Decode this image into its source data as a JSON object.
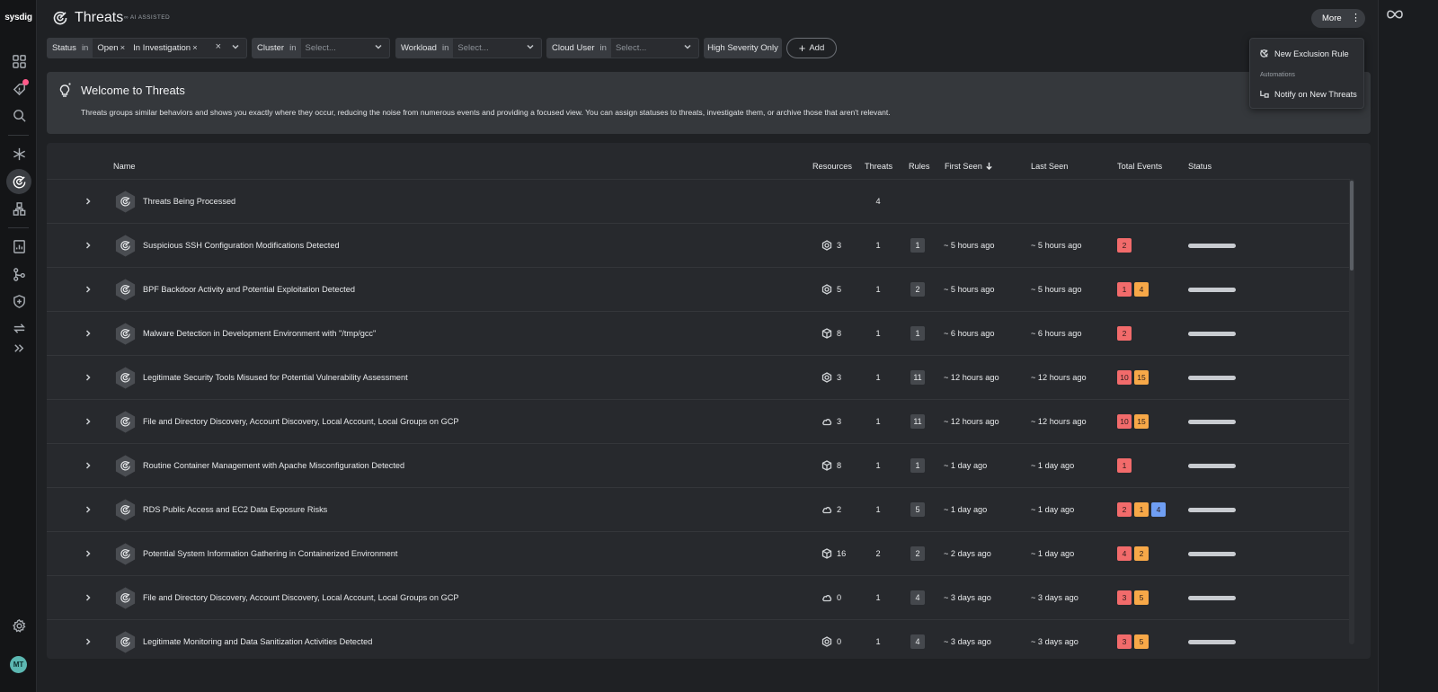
{
  "nav": {
    "logo": "sysdig",
    "avatar_initials": "MT"
  },
  "header": {
    "title": "Threats",
    "ai_badge": "AI ASSISTED",
    "more_label": "More"
  },
  "filters": {
    "status": {
      "name": "Status",
      "op": "in",
      "chips": [
        "Open",
        "In Investigation"
      ]
    },
    "cluster": {
      "name": "Cluster",
      "op": "in",
      "placeholder": "Select..."
    },
    "workload": {
      "name": "Workload",
      "op": "in",
      "placeholder": "Select..."
    },
    "cloud_user": {
      "name": "Cloud User",
      "op": "in",
      "placeholder": "Select..."
    },
    "high_severity_label": "High Severity Only",
    "add_label": "Add"
  },
  "menu": {
    "new_exclusion_rule": "New Exclusion Rule",
    "section": "Automations",
    "notify_new_threats": "Notify on New Threats"
  },
  "welcome": {
    "title": "Welcome to Threats",
    "text": "Threats groups similar behaviors and shows you exactly where they occur, reducing the noise from numerous events and providing a focused view. You can assign statuses to threats, investigate them, or archive those that aren't relevant."
  },
  "table": {
    "columns": {
      "name": "Name",
      "resources": "Resources",
      "threats": "Threats",
      "rules": "Rules",
      "first_seen": "First Seen",
      "last_seen": "Last Seen",
      "total_events": "Total Events",
      "status": "Status"
    },
    "rows": [
      {
        "name": "Threats Being Processed",
        "resource_icon": "",
        "resources": "",
        "threats": "4",
        "rules": "",
        "first_seen": "",
        "last_seen": "",
        "events": [],
        "status": false
      },
      {
        "name": "Suspicious SSH Configuration Modifications Detected",
        "resource_icon": "host-icon",
        "resources": "3",
        "threats": "1",
        "rules": "1",
        "first_seen": "~ 5 hours ago",
        "last_seen": "~ 5 hours ago",
        "events": [
          {
            "v": "2",
            "sev": "high"
          }
        ],
        "status": true
      },
      {
        "name": "BPF Backdoor Activity and Potential Exploitation Detected",
        "resource_icon": "host-icon",
        "resources": "5",
        "threats": "1",
        "rules": "2",
        "first_seen": "~ 5 hours ago",
        "last_seen": "~ 5 hours ago",
        "events": [
          {
            "v": "1",
            "sev": "high"
          },
          {
            "v": "4",
            "sev": "med"
          }
        ],
        "status": true
      },
      {
        "name": "Malware Detection in Development Environment with \"/tmp/gcc\"",
        "resource_icon": "container-icon",
        "resources": "8",
        "threats": "1",
        "rules": "1",
        "first_seen": "~ 6 hours ago",
        "last_seen": "~ 6 hours ago",
        "events": [
          {
            "v": "2",
            "sev": "high"
          }
        ],
        "status": true
      },
      {
        "name": "Legitimate Security Tools Misused for Potential Vulnerability Assessment",
        "resource_icon": "host-icon",
        "resources": "3",
        "threats": "1",
        "rules": "11",
        "first_seen": "~ 12 hours ago",
        "last_seen": "~ 12 hours ago",
        "events": [
          {
            "v": "10",
            "sev": "high"
          },
          {
            "v": "15",
            "sev": "med"
          }
        ],
        "status": true
      },
      {
        "name": "File and Directory Discovery, Account Discovery, Local Account, Local Groups on GCP",
        "resource_icon": "cloud-icon",
        "resources": "3",
        "threats": "1",
        "rules": "11",
        "first_seen": "~ 12 hours ago",
        "last_seen": "~ 12 hours ago",
        "events": [
          {
            "v": "10",
            "sev": "high"
          },
          {
            "v": "15",
            "sev": "med"
          }
        ],
        "status": true
      },
      {
        "name": "Routine Container Management with Apache Misconfiguration Detected",
        "resource_icon": "container-icon",
        "resources": "8",
        "threats": "1",
        "rules": "1",
        "first_seen": "~ 1 day ago",
        "last_seen": "~ 1 day ago",
        "events": [
          {
            "v": "1",
            "sev": "high"
          }
        ],
        "status": true
      },
      {
        "name": "RDS Public Access and EC2 Data Exposure Risks",
        "resource_icon": "cloud-icon",
        "resources": "2",
        "threats": "1",
        "rules": "5",
        "first_seen": "~ 1 day ago",
        "last_seen": "~ 1 day ago",
        "events": [
          {
            "v": "2",
            "sev": "high"
          },
          {
            "v": "1",
            "sev": "med"
          },
          {
            "v": "4",
            "sev": "low"
          }
        ],
        "status": true
      },
      {
        "name": "Potential System Information Gathering in Containerized Environment",
        "resource_icon": "container-icon",
        "resources": "16",
        "threats": "2",
        "rules": "2",
        "first_seen": "~ 2 days ago",
        "last_seen": "~ 1 day ago",
        "events": [
          {
            "v": "4",
            "sev": "high"
          },
          {
            "v": "2",
            "sev": "med"
          }
        ],
        "status": true
      },
      {
        "name": "File and Directory Discovery, Account Discovery, Local Account, Local Groups on GCP",
        "resource_icon": "cloud-icon",
        "resources": "0",
        "threats": "1",
        "rules": "4",
        "first_seen": "~ 3 days ago",
        "last_seen": "~ 3 days ago",
        "events": [
          {
            "v": "3",
            "sev": "high"
          },
          {
            "v": "5",
            "sev": "med"
          }
        ],
        "status": true
      },
      {
        "name": "Legitimate Monitoring and Data Sanitization Activities Detected",
        "resource_icon": "host-icon",
        "resources": "0",
        "threats": "1",
        "rules": "4",
        "first_seen": "~ 3 days ago",
        "last_seen": "~ 3 days ago",
        "events": [
          {
            "v": "3",
            "sev": "high"
          },
          {
            "v": "5",
            "sev": "med"
          }
        ],
        "status": true
      }
    ]
  },
  "colors": {
    "high": "#f26b6b",
    "medium": "#f7a848",
    "low": "#6f9ef3",
    "notification": "#ff5a8a"
  }
}
